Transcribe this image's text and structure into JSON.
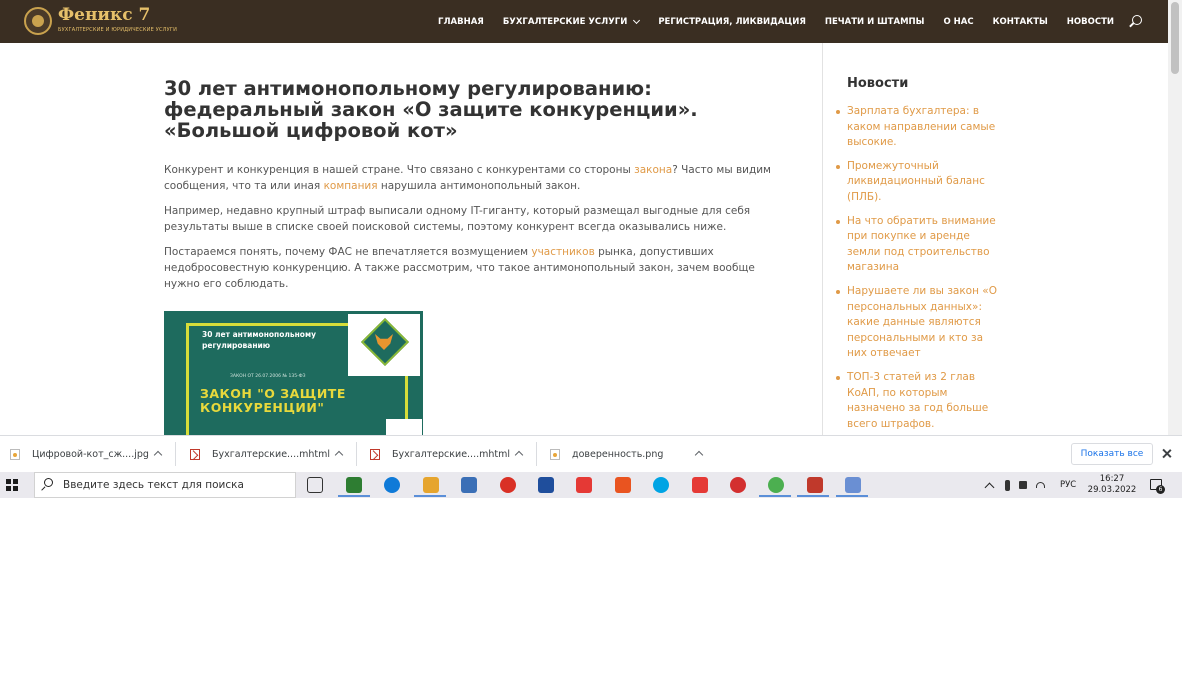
{
  "site": {
    "logo_name": "Феникс 7",
    "logo_sub": "БУХГАЛТЕРСКИЕ И ЮРИДИЧЕСКИЕ УСЛУГИ"
  },
  "nav": {
    "items": [
      "ГЛАВНАЯ",
      "БУХГАЛТЕРСКИЕ УСЛУГИ",
      "РЕГИСТРАЦИЯ, ЛИКВИДАЦИЯ",
      "ПЕЧАТИ И ШТАМПЫ",
      "О НАС",
      "КОНТАКТЫ",
      "НОВОСТИ"
    ],
    "search_icon": "search-icon"
  },
  "article": {
    "title": "30 лет антимонопольному регулированию: федеральный закон «О защите конкуренции». «Большой цифровой кот»",
    "p1_a": "Конкурент и конкуренция в нашей стране. Что связано с конкурентами со стороны ",
    "p1_link1": "закона",
    "p1_b": "? Часто мы видим сообщения, что та или иная ",
    "p1_link2": "компания",
    "p1_c": " нарушила антимонопольный закон.",
    "p2": "Например, недавно крупный штраф выписали одному IT-гиганту, который размещал выгодные для себя результаты выше в списке своей поисковой системы, поэтому конкурент всегда оказывались ниже.",
    "p3_a": "Постараемся понять, почему ФАС не впечатляется возмущением ",
    "p3_link": "участников",
    "p3_b": " рынка, допустивших недобросовестную конкуренцию. А также рассмотрим, что такое антимонопольный закон, зачем вообще нужно его соблюдать.",
    "poster_line1": "30 лет антимонопольному регулированию",
    "poster_line2": "ЗАКОН ОТ 26.07.2006 № 135-ФЗ",
    "poster_line3": "ЗАКОН \"О ЗАЩИТЕ КОНКУРЕНЦИИ\""
  },
  "sidebar": {
    "title": "Новости",
    "news": [
      "Зарплата бухгалтера: в каком направлении самые высокие.",
      "Промежуточный ликвидационный баланс (ПЛБ).",
      "На что обратить внимание при покупке и аренде земли под строительство магазина",
      "Нарушаете ли вы закон «О персональных данных»: какие данные являются персональными и кто за них отвечает",
      "ТОП-3 статей из 2 глав КоАП, по которым назначено за год больше всего штрафов."
    ]
  },
  "downloads": {
    "items": [
      "Цифровой-кот_сж....jpg",
      "Бухгалтерские....mhtml",
      "Бухгалтерские....mhtml",
      "доверенность.png"
    ],
    "show_all": "Показать все"
  },
  "taskbar": {
    "search_placeholder": "Введите здесь текст для поиска",
    "lang": "РУС",
    "time": "16:27",
    "date": "29.03.2022",
    "notif_count": "6",
    "icon_colors": [
      "#2e7d32",
      "#0f7ad8",
      "#e6a52e",
      "#3b6fb6",
      "#d93025",
      "#1f4e9c",
      "#e53935",
      "#e95420",
      "#00a4e4",
      "#e53935",
      "#d32f2f",
      "#4caf50",
      "#c0392b",
      "#6a8fd3"
    ]
  }
}
